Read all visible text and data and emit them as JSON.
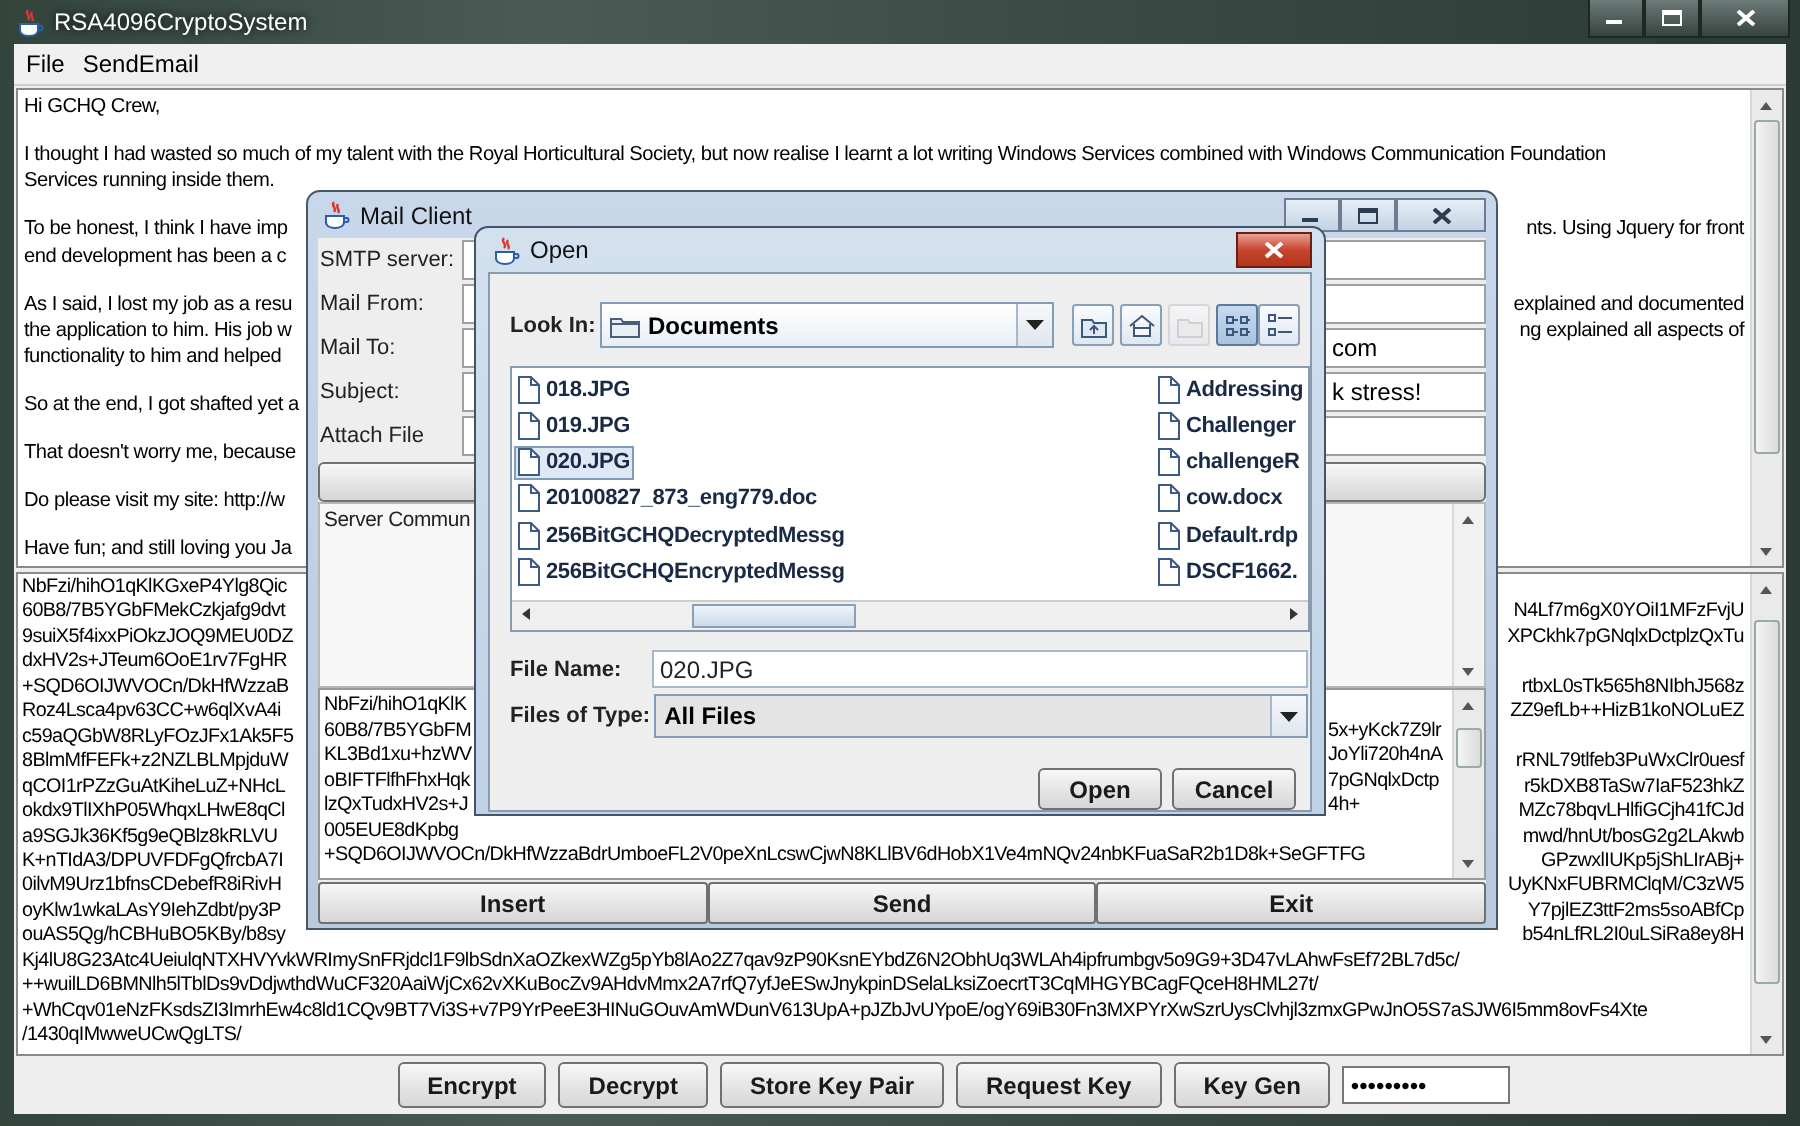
{
  "window": {
    "title": "RSA4096CryptoSystem"
  },
  "menu": [
    "File",
    "SendEmail"
  ],
  "message": [
    {
      "lines": [
        {
          "left": "Hi GCHQ Crew,"
        }
      ]
    },
    {
      "lines": [
        {
          "left": "I thought I had wasted so much of my talent with the Royal Horticultural Society, but now realise I learnt a lot writing Windows Services combined with Windows Communication Foundation"
        },
        {
          "left": "Services running inside them."
        }
      ]
    },
    {
      "lines": [
        {
          "left": "To be honest, I think I have imp",
          "right": "nts. Using Jquery for front"
        },
        {
          "left": "end development has been a c"
        }
      ]
    },
    {
      "lines": [
        {
          "left": "As I said, I lost my job as a resu",
          "right": "explained and documented"
        },
        {
          "left": "the application to him. His job w",
          "right": "ng explained all aspects of"
        },
        {
          "left": "functionality to him and helped"
        }
      ]
    },
    {
      "lines": [
        {
          "left": "So at the end, I got shafted yet a"
        }
      ]
    },
    {
      "lines": [
        {
          "left": "That doesn't worry me, because"
        }
      ]
    },
    {
      "lines": [
        {
          "left": "Do please visit my site: http://w"
        }
      ]
    },
    {
      "lines": [
        {
          "left": "Have fun; and still loving you Ja"
        }
      ]
    }
  ],
  "ciphertext": [
    {
      "left": "NbFzi/hihO1qKlKGxeP4Ylg8Qic"
    },
    {
      "left": "60B8/7B5YGbFMekCzkjafg9dvt",
      "right": "N4Lf7m6gX0YOiI1MFzFvjU"
    },
    {
      "left": "9suiX5f4ixxPiOkzJOQ9MEU0DZ",
      "right": "XPCkhk7pGNqlxDctplzQxTu"
    },
    {
      "left": "dxHV2s+JTeum6OoE1rv7FgHR"
    },
    {
      "left": "+SQD6OIJWVOCn/DkHfWzzaB",
      "right": "rtbxL0sTk565h8NIbhJ568z"
    },
    {
      "left": "Roz4Lsca4pv63CC+w6qlXvA4i",
      "right": "ZZ9efLb++HizB1koNOLuEZ"
    },
    {
      "left": "c59aQGbW8RLyFOzJFx1Ak5F5"
    },
    {
      "left": "8BlmMfFEFk+z2NZLBLMpjduW",
      "right": "rRNL79tlfeb3PuWxClr0uesf"
    },
    {
      "left": "qCOI1rPZzGuAtKiheLuZ+NHcL",
      "right": "r5kDXB8TaSw7IaF523hkZ"
    },
    {
      "left": "okdx9TlIXhP05WhqxLHwE8qCl",
      "right": "MZc78bqvLHlfiGCjh41fCJd"
    },
    {
      "left": "a9SGJk36Kf5g9eQBlz8kRLVU",
      "right": "mwd/hnUt/bosG2g2LAkwb"
    },
    {
      "left": "K+nTIdA3/DPUVFDFgQfrcbA7I",
      "right": "GPzwxlIUKp5jShLIrABj+"
    },
    {
      "left": "0ilvM9Urz1bfnsCDebefR8iRivH",
      "right": "UyKNxFUBRMClqM/C3zW5"
    },
    {
      "left": "oyKlw1wkaLAsY9IehZdbt/py3P",
      "right": "Y7pjlEZ3ttF2ms5soABfCp"
    },
    {
      "left": "ouAS5Qg/hCBHuBO5KBy/b8sy",
      "right": "b54nLfRL2I0uLSiRa8ey8H"
    },
    {
      "left": "Kj4lU8G23Atc4UeiulqNTXHVYvkWRImySnFRjdcl1F9lbSdnXaOZkexWZg5pYb8lAo2Z7qav9zP90KsnEYbdZ6N2ObhUq3WLAh4ipfrumbgv5o9G9+3D47vLAhwFsEf72BL7d5c/"
    },
    {
      "left": "++wuilLD6BMNlh5lTblDs9vDdjwthdWuCF320AaiWjCx62vXKuBocZv9AHdvMmx2A7rfQ7yfJeESwJnykpinDSelaLksiZoecrtT3CqMHGYBCagFQceH8HML27t/"
    },
    {
      "left": "+WhCqv01eNzFKsdsZI3ImrhEw4c8ld1CQv9BT7Vi3S+v7P9YrPeeE3HINuGOuvAmWDunV613UpA+pJZbJvUYpoE/ogY69iB30Fn3MXPYrXwSzrUysClvhjl3zmxGPwJnO5S7aSJW6I5mm8ovFs4Xte"
    },
    {
      "left": "/1430qIMwweUCwQgLTS/"
    }
  ],
  "buttons": [
    "Encrypt",
    "Decrypt",
    "Store Key Pair",
    "Request Key",
    "Key Gen"
  ],
  "password": {
    "value": "•••••••••"
  },
  "mail_client": {
    "title": "Mail Client",
    "fields": [
      {
        "label": "SMTP server:"
      },
      {
        "label": "Mail From:"
      },
      {
        "label": "Mail To:",
        "value": "com"
      },
      {
        "label": "Subject:",
        "value": "k stress!"
      },
      {
        "label": "Attach File"
      }
    ],
    "server_log": "Server Commun",
    "message_lines": [
      {
        "left": "NbFzi/hihO1qKlK"
      },
      {
        "left": "60B8/7B5YGbFM",
        "right": "5x+yKck7Z9lr"
      },
      {
        "left": "KL3Bd1xu+hzWV",
        "right": "JoYli720h4nA"
      },
      {
        "left": "oBIFTFlfhFhxHqk",
        "right": "7pGNqlxDctp"
      },
      {
        "left": "lzQxTudxHV2s+J",
        "right": "4h+"
      },
      {
        "left": "005EUE8dKpbg"
      },
      {
        "left": "+SQD6OIJWVOCn/DkHfWzzaBdrUmboeFL2V0peXnLcswCjwN8KLlBV6dHobX1Ve4mNQv24nbKFuaSaR2b1D8k+SeGFTFG"
      }
    ],
    "buttons": [
      "Insert",
      "Send",
      "Exit"
    ]
  },
  "open_dialog": {
    "title": "Open",
    "look_in": {
      "label": "Look In:",
      "value": "Documents"
    },
    "toolbar": [
      {
        "kind": "up",
        "disabled": false,
        "selected": false
      },
      {
        "kind": "home",
        "disabled": false,
        "selected": false
      },
      {
        "kind": "new_folder",
        "disabled": true,
        "selected": false
      },
      {
        "kind": "list",
        "disabled": false,
        "selected": true
      },
      {
        "kind": "details",
        "disabled": false,
        "selected": false
      }
    ],
    "files": [
      {
        "name": "018.JPG",
        "selected": false
      },
      {
        "name": "019.JPG",
        "selected": false
      },
      {
        "name": "020.JPG",
        "selected": true
      },
      {
        "name": "20100827_873_eng779.doc",
        "selected": false
      },
      {
        "name": "256BitGCHQDecryptedMessg",
        "selected": false
      },
      {
        "name": "256BitGCHQEncryptedMessg",
        "selected": false
      },
      {
        "name": "Addressing",
        "selected": false
      },
      {
        "name": "Challenger",
        "selected": false
      },
      {
        "name": "challengeR",
        "selected": false
      },
      {
        "name": "cow.docx",
        "selected": false
      },
      {
        "name": "Default.rdp",
        "selected": false
      },
      {
        "name": "DSCF1662.",
        "selected": false
      }
    ],
    "file_name": {
      "label": "File Name:",
      "value": "020.JPG"
    },
    "file_type": {
      "label": "Files of Type:",
      "value": "All Files"
    },
    "buttons": [
      "Open",
      "Cancel"
    ]
  }
}
